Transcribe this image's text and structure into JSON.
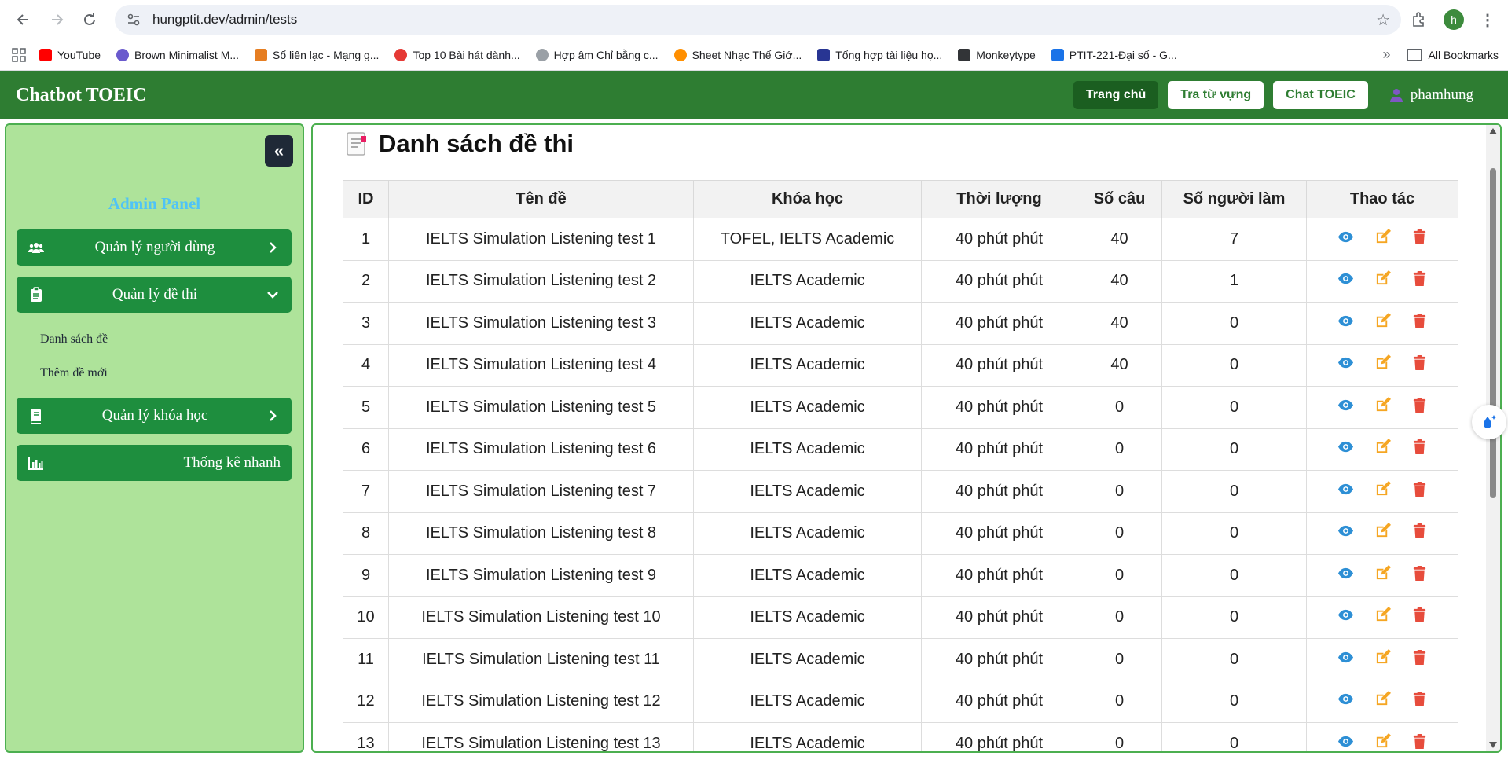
{
  "browser": {
    "url": "hungptit.dev/admin/tests",
    "profile_initial": "h",
    "bookmarks": [
      {
        "label": "YouTube",
        "color": "#ff0000"
      },
      {
        "label": "Brown Minimalist M...",
        "color": "#6a5acd"
      },
      {
        "label": "Sổ liên lạc - Mạng g...",
        "color": "#e67e22"
      },
      {
        "label": "Top 10 Bài hát dành...",
        "color": "#e53935"
      },
      {
        "label": "Hợp âm Chỉ bằng c...",
        "color": "#9aa0a6"
      },
      {
        "label": "Sheet Nhạc Thế Giớ...",
        "color": "#ff8f00"
      },
      {
        "label": "Tổng hợp tài liệu họ...",
        "color": "#283593"
      },
      {
        "label": "Monkeytype",
        "color": "#323437"
      },
      {
        "label": "PTIT-221-Đại số - G...",
        "color": "#1a73e8"
      }
    ],
    "more_bookmarks": "»",
    "all_bookmarks": "All Bookmarks"
  },
  "header": {
    "title": "Chatbot TOEIC",
    "home_label": "Trang chủ",
    "vocab_label": "Tra từ vựng",
    "chat_label": "Chat TOEIC",
    "username": "phamhung"
  },
  "sidebar": {
    "panel_title": "Admin Panel",
    "users_label": "Quản lý người dùng",
    "tests_label": "Quản lý đề thi",
    "tests_sub": [
      "Danh sách đề",
      "Thêm đề mới"
    ],
    "courses_label": "Quản lý khóa học",
    "stats_label": "Thống kê nhanh"
  },
  "main": {
    "heading": "Danh sách đề thi",
    "columns": [
      "ID",
      "Tên đề",
      "Khóa học",
      "Thời lượng",
      "Số câu",
      "Số người làm",
      "Thao tác"
    ],
    "rows": [
      {
        "id": "1",
        "name": "IELTS Simulation Listening test 1",
        "course": "TOFEL, IELTS Academic",
        "duration": "40 phút phút",
        "questions": "40",
        "takers": "7"
      },
      {
        "id": "2",
        "name": "IELTS Simulation Listening test 2",
        "course": "IELTS Academic",
        "duration": "40 phút phút",
        "questions": "40",
        "takers": "1"
      },
      {
        "id": "3",
        "name": "IELTS Simulation Listening test 3",
        "course": "IELTS Academic",
        "duration": "40 phút phút",
        "questions": "40",
        "takers": "0"
      },
      {
        "id": "4",
        "name": "IELTS Simulation Listening test 4",
        "course": "IELTS Academic",
        "duration": "40 phút phút",
        "questions": "40",
        "takers": "0"
      },
      {
        "id": "5",
        "name": "IELTS Simulation Listening test 5",
        "course": "IELTS Academic",
        "duration": "40 phút phút",
        "questions": "0",
        "takers": "0"
      },
      {
        "id": "6",
        "name": "IELTS Simulation Listening test 6",
        "course": "IELTS Academic",
        "duration": "40 phút phút",
        "questions": "0",
        "takers": "0"
      },
      {
        "id": "7",
        "name": "IELTS Simulation Listening test 7",
        "course": "IELTS Academic",
        "duration": "40 phút phút",
        "questions": "0",
        "takers": "0"
      },
      {
        "id": "8",
        "name": "IELTS Simulation Listening test 8",
        "course": "IELTS Academic",
        "duration": "40 phút phút",
        "questions": "0",
        "takers": "0"
      },
      {
        "id": "9",
        "name": "IELTS Simulation Listening test 9",
        "course": "IELTS Academic",
        "duration": "40 phút phút",
        "questions": "0",
        "takers": "0"
      },
      {
        "id": "10",
        "name": "IELTS Simulation Listening test 10",
        "course": "IELTS Academic",
        "duration": "40 phút phút",
        "questions": "0",
        "takers": "0"
      },
      {
        "id": "11",
        "name": "IELTS Simulation Listening test 11",
        "course": "IELTS Academic",
        "duration": "40 phút phút",
        "questions": "0",
        "takers": "0"
      },
      {
        "id": "12",
        "name": "IELTS Simulation Listening test 12",
        "course": "IELTS Academic",
        "duration": "40 phút phút",
        "questions": "0",
        "takers": "0"
      },
      {
        "id": "13",
        "name": "IELTS Simulation Listening test 13",
        "course": "IELTS Academic",
        "duration": "40 phút phút",
        "questions": "0",
        "takers": "0"
      }
    ]
  },
  "colors": {
    "header_green": "#2e7d32",
    "sidebar_bg": "#aee39a",
    "menu_green": "#1e8e3e",
    "view_icon": "#2d8fd5",
    "edit_icon": "#f5a623",
    "delete_icon": "#e74c3c"
  },
  "icons": {
    "back": "arrow-left-icon",
    "forward": "arrow-right-icon",
    "reload": "reload-icon",
    "view": "eye-icon",
    "edit": "edit-icon",
    "delete": "trash-icon"
  }
}
